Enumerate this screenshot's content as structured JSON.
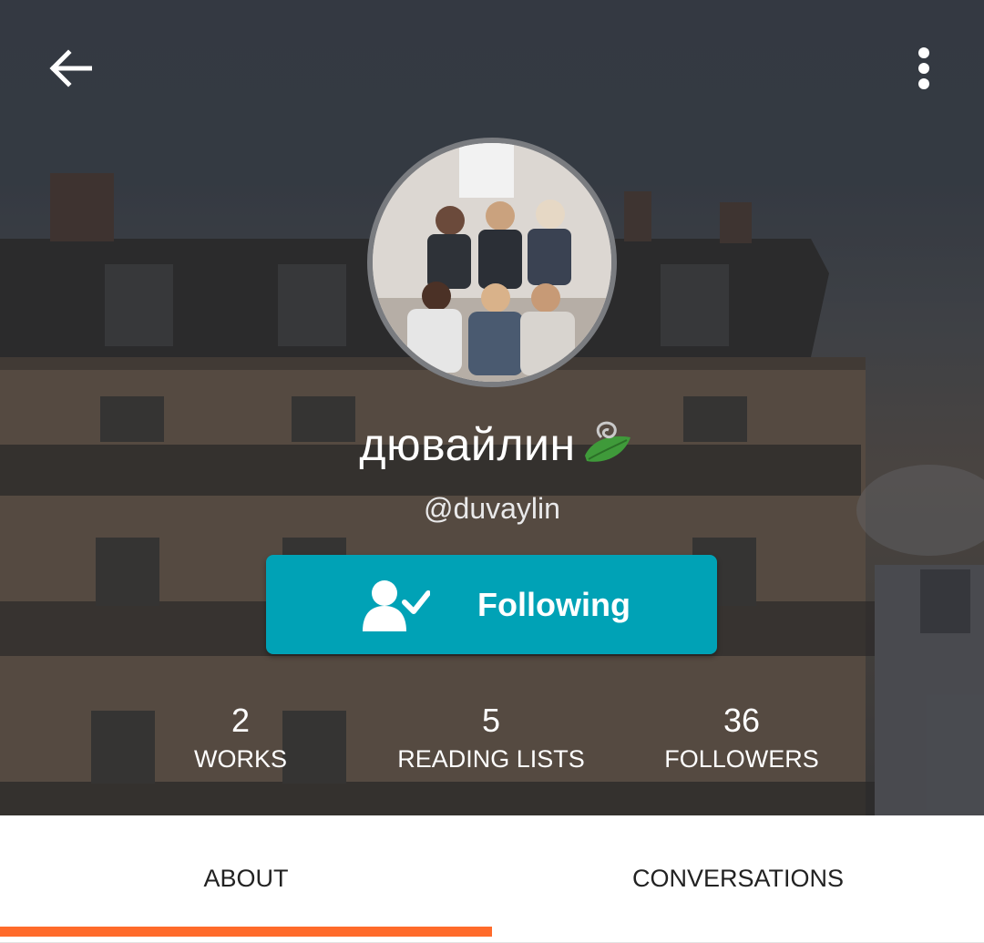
{
  "profile": {
    "display_name": "дювайлин",
    "username": "@duvaylin",
    "badge_icon": "leaf-badge-icon",
    "follow_label": "Following"
  },
  "stats": [
    {
      "value": "2",
      "label": "WORKS"
    },
    {
      "value": "5",
      "label": "READING LISTS"
    },
    {
      "value": "36",
      "label": "FOLLOWERS"
    }
  ],
  "tabs": [
    {
      "label": "ABOUT",
      "active": true
    },
    {
      "label": "CONVERSATIONS",
      "active": false
    }
  ],
  "colors": {
    "follow_button": "#00a2b6",
    "active_tab_indicator": "#ff6b2b"
  }
}
